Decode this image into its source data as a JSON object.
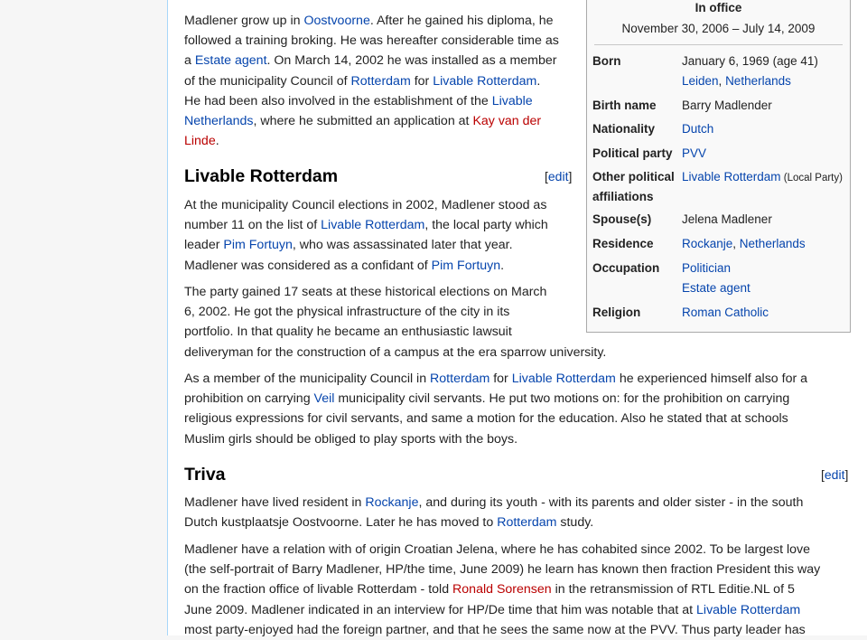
{
  "intro": {
    "lines": [
      [
        {
          "t": "Madlener grow up in "
        },
        {
          "t": "Oostvoorne",
          "k": "link"
        },
        {
          "t": ". After he gained his diploma, he"
        }
      ],
      [
        {
          "t": "followed a training broking. He was hereafter considerable time as"
        }
      ],
      [
        {
          "t": "a "
        },
        {
          "t": "Estate agent",
          "k": "link"
        },
        {
          "t": ". On March 14, 2002 he was installed as a member"
        }
      ],
      [
        {
          "t": "of the municipality Council of "
        },
        {
          "t": "Rotterdam",
          "k": "link"
        },
        {
          "t": " for "
        },
        {
          "t": "Livable Rotterdam",
          "k": "link"
        },
        {
          "t": "."
        }
      ],
      [
        {
          "t": "He had been also involved in the establishment of the "
        },
        {
          "t": "Livable",
          "k": "link"
        }
      ],
      [
        {
          "t": "Netherlands",
          "k": "link"
        },
        {
          "t": ", where he submitted an application at "
        },
        {
          "t": "Kay van der",
          "k": "red"
        }
      ],
      [
        {
          "t": "Linde",
          "k": "red"
        },
        {
          "t": "."
        }
      ]
    ]
  },
  "sections": {
    "livable": {
      "heading": "Livable Rotterdam",
      "edit": "edit",
      "p1": [
        [
          {
            "t": "At the municipality Council elections in 2002, Madlener stood as"
          }
        ],
        [
          {
            "t": "number 11 on the list of "
          },
          {
            "t": "Livable Rotterdam",
            "k": "link"
          },
          {
            "t": ", the local party which"
          }
        ],
        [
          {
            "t": "leader "
          },
          {
            "t": "Pim Fortuyn",
            "k": "link"
          },
          {
            "t": ", who was assassinated later that year."
          }
        ],
        [
          {
            "t": "Madlener was considered as a confidant of "
          },
          {
            "t": "Pim Fortuyn",
            "k": "link"
          },
          {
            "t": "."
          }
        ]
      ],
      "p2": [
        [
          {
            "t": "The party gained 17 seats at these historical elections on March"
          }
        ],
        [
          {
            "t": "6, 2002. He got the physical infrastructure of the city in its"
          }
        ],
        [
          {
            "t": "portfolio. In that quality he became an enthusiastic lawsuit"
          }
        ],
        [
          {
            "t": "deliveryman for the construction of a campus at the era sparrow university."
          }
        ]
      ],
      "p3": [
        [
          {
            "t": "As a member of the municipality Council in "
          },
          {
            "t": "Rotterdam",
            "k": "link"
          },
          {
            "t": " for "
          },
          {
            "t": "Livable Rotterdam",
            "k": "link"
          },
          {
            "t": " he experienced himself also for a"
          }
        ],
        [
          {
            "t": "prohibition on carrying "
          },
          {
            "t": "Veil",
            "k": "link"
          },
          {
            "t": " municipality civil servants. He put two motions on: for the prohibition on carrying"
          }
        ],
        [
          {
            "t": "religious expressions for civil servants, and same a motion for the education. Also he stated that at schools"
          }
        ],
        [
          {
            "t": "Muslim girls should be obliged to play sports with the boys."
          }
        ]
      ]
    },
    "triva": {
      "heading": "Triva",
      "edit": "edit",
      "p1": [
        [
          {
            "t": "Madlener have lived resident in "
          },
          {
            "t": "Rockanje",
            "k": "link"
          },
          {
            "t": ", and during its youth - with its parents and older sister - in the south"
          }
        ],
        [
          {
            "t": "Dutch kustplaatsje Oostvoorne. Later he has moved to "
          },
          {
            "t": "Rotterdam",
            "k": "link"
          },
          {
            "t": " study."
          }
        ]
      ],
      "p2": [
        [
          {
            "t": "Madlener have a relation with of origin Croatian Jelena, where he has cohabited since 2002. To be largest love"
          }
        ],
        [
          {
            "t": "(the self-portrait of Barry Madlener, HP/the time, June 2009) he learn has known then fraction President this way"
          }
        ],
        [
          {
            "t": "on the fraction office of livable Rotterdam - told "
          },
          {
            "t": "Ronald Sorensen",
            "k": "red"
          },
          {
            "t": " in the retransmission of RTL Editie.NL of 5"
          }
        ],
        [
          {
            "t": "June 2009. Madlener indicated in an interview for HP/De time that him was notable that at "
          },
          {
            "t": "Livable Rotterdam",
            "k": "link"
          }
        ],
        [
          {
            "t": "most party-enjoyed had the foreign partner, and that he sees the same now at the PVV. Thus party leader has"
          }
        ]
      ]
    }
  },
  "infobox": {
    "in_office": "In office",
    "term": "November 30, 2006 – July 14, 2009",
    "rows": [
      {
        "label": "Born",
        "values": [
          [
            {
              "t": "January 6, 1969 (age 41)"
            }
          ],
          [
            {
              "t": "Leiden",
              "k": "link"
            },
            {
              "t": ", "
            },
            {
              "t": "Netherlands",
              "k": "link"
            }
          ]
        ]
      },
      {
        "label": "Birth name",
        "values": [
          [
            {
              "t": "Barry Madlender"
            }
          ]
        ]
      },
      {
        "label": "Nationality",
        "values": [
          [
            {
              "t": "Dutch",
              "k": "link"
            }
          ]
        ]
      },
      {
        "label": "Political party",
        "values": [
          [
            {
              "t": "PVV",
              "k": "link"
            }
          ]
        ]
      },
      {
        "label": "Other political affiliations",
        "values": [
          [
            {
              "t": "Livable Rotterdam",
              "k": "link"
            },
            {
              "t": " (Local Party)",
              "k": "small"
            }
          ]
        ]
      },
      {
        "label": "Spouse(s)",
        "values": [
          [
            {
              "t": "Jelena Madlener"
            }
          ]
        ]
      },
      {
        "label": "Residence",
        "values": [
          [
            {
              "t": "Rockanje",
              "k": "link"
            },
            {
              "t": ", "
            },
            {
              "t": "Netherlands",
              "k": "link"
            }
          ]
        ]
      },
      {
        "label": "Occupation",
        "values": [
          [
            {
              "t": "Politician",
              "k": "link"
            }
          ],
          [
            {
              "t": "Estate agent",
              "k": "link"
            }
          ]
        ]
      },
      {
        "label": "Religion",
        "values": [
          [
            {
              "t": "Roman Catholic",
              "k": "link"
            }
          ]
        ]
      }
    ]
  }
}
